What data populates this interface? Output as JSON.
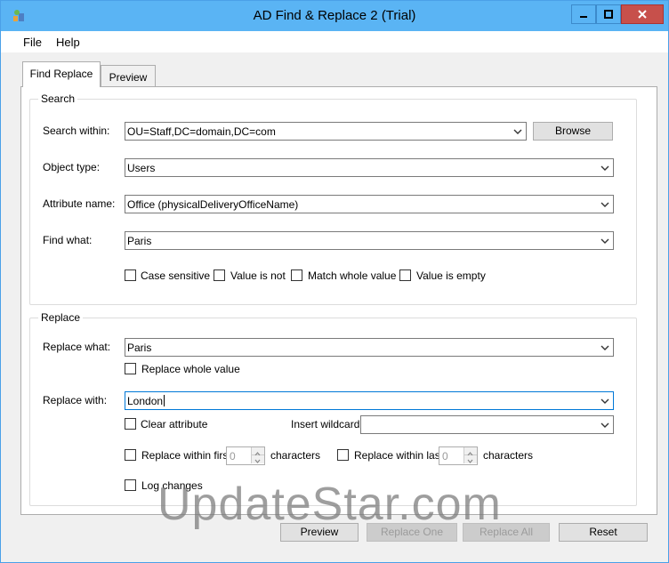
{
  "window": {
    "title": "AD Find & Replace 2 (Trial)"
  },
  "menu": {
    "file": "File",
    "help": "Help"
  },
  "tabs": {
    "find_replace": "Find Replace",
    "preview": "Preview"
  },
  "search": {
    "group_label": "Search",
    "search_within_label": "Search within:",
    "search_within_value": "OU=Staff,DC=domain,DC=com",
    "browse_label": "Browse",
    "object_type_label": "Object type:",
    "object_type_value": "Users",
    "attribute_name_label": "Attribute name:",
    "attribute_name_value": "Office (physicalDeliveryOfficeName)",
    "find_what_label": "Find what:",
    "find_what_value": "Paris",
    "case_sensitive_label": "Case sensitive",
    "value_is_not_label": "Value is not",
    "match_whole_value_label": "Match whole value",
    "value_is_empty_label": "Value is empty"
  },
  "replace": {
    "group_label": "Replace",
    "replace_what_label": "Replace what:",
    "replace_what_value": "Paris",
    "replace_whole_value_label": "Replace whole value",
    "replace_with_label": "Replace with:",
    "replace_with_value": "London",
    "clear_attribute_label": "Clear attribute",
    "insert_wildcard_label": "Insert wildcard",
    "insert_wildcard_value": "",
    "replace_within_first_label": "Replace within first",
    "first_chars_value": "0",
    "characters_label_1": "characters",
    "replace_within_last_label": "Replace within last",
    "last_chars_value": "0",
    "characters_label_2": "characters",
    "log_changes_label": "Log changes"
  },
  "buttons": {
    "preview": "Preview",
    "replace_one": "Replace One",
    "replace_all": "Replace All",
    "reset": "Reset"
  },
  "watermark": "UpdateStar.com",
  "colors": {
    "titlebar": "#5ab4f4",
    "close_button": "#c7504b",
    "focus_border": "#0078d7"
  }
}
